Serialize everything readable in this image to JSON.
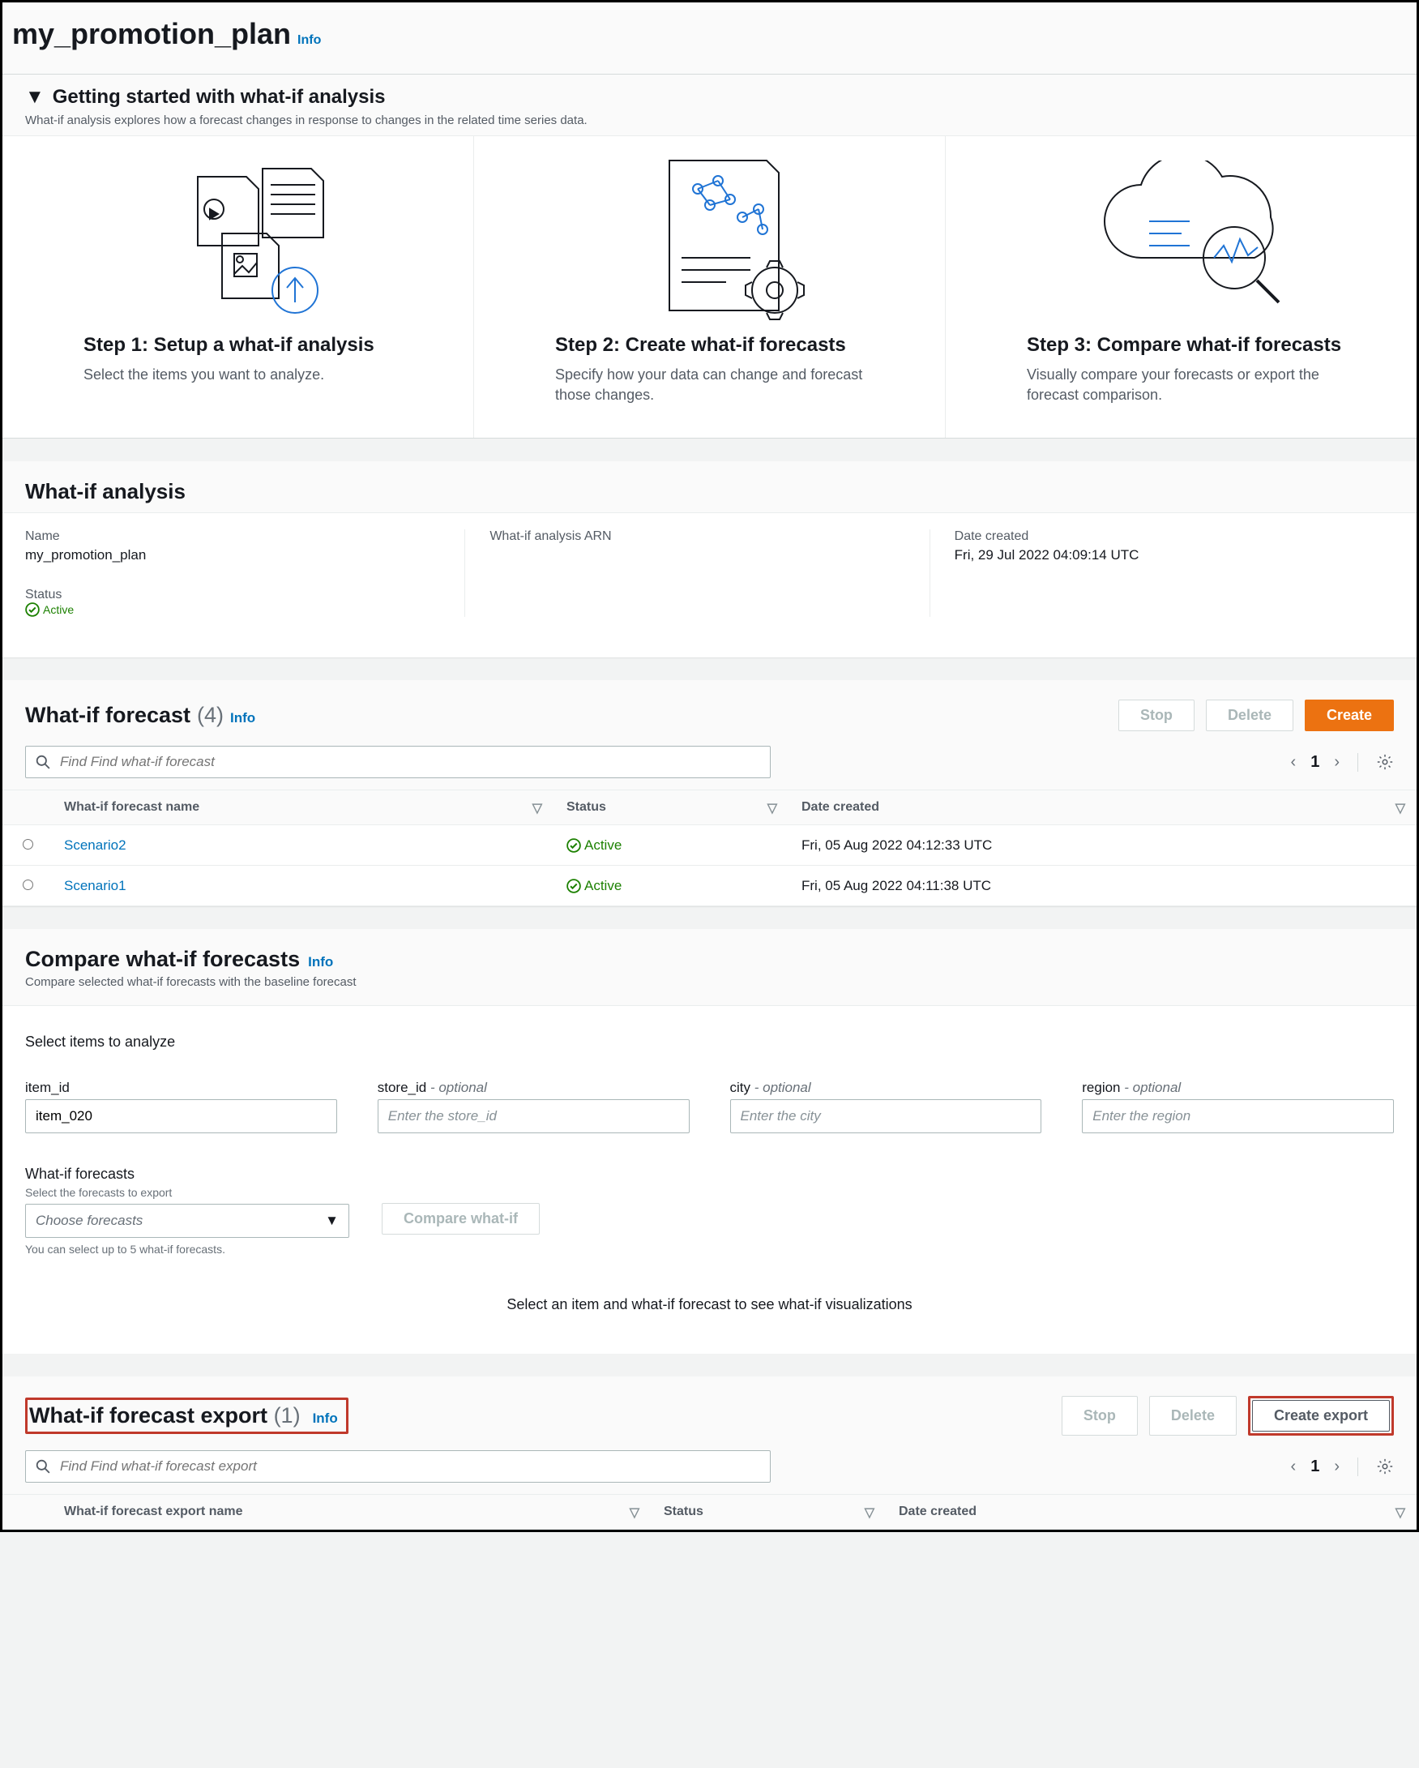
{
  "page": {
    "title": "my_promotion_plan",
    "info": "Info"
  },
  "getting_started": {
    "title": "Getting started with what-if analysis",
    "desc": "What-if analysis explores how a forecast changes in response to changes in the related time series data.",
    "steps": [
      {
        "title": "Step 1: Setup a what-if analysis",
        "desc": "Select the items you want to analyze."
      },
      {
        "title": "Step 2: Create what-if forecasts",
        "desc": "Specify how your data can change and forecast those changes."
      },
      {
        "title": "Step 3: Compare what-if forecasts",
        "desc": "Visually compare your forecasts or export the forecast comparison."
      }
    ]
  },
  "analysis": {
    "header": "What-if analysis",
    "name_label": "Name",
    "name_value": "my_promotion_plan",
    "arn_label": "What-if analysis ARN",
    "date_label": "Date created",
    "date_value": "Fri, 29 Jul 2022 04:09:14 UTC",
    "status_label": "Status",
    "status_value": "Active"
  },
  "forecast": {
    "title": "What-if forecast",
    "count": "(4)",
    "info": "Info",
    "stop": "Stop",
    "delete": "Delete",
    "create": "Create",
    "search_placeholder": "Find Find what-if forecast",
    "page_current": "1",
    "columns": {
      "name": "What-if forecast name",
      "status": "Status",
      "date": "Date created"
    },
    "rows": [
      {
        "name": "Scenario2",
        "status": "Active",
        "date": "Fri, 05 Aug 2022 04:12:33 UTC"
      },
      {
        "name": "Scenario1",
        "status": "Active",
        "date": "Fri, 05 Aug 2022 04:11:38 UTC"
      }
    ]
  },
  "compare": {
    "title": "Compare what-if forecasts",
    "info": "Info",
    "sub": "Compare selected what-if forecasts with the baseline forecast",
    "select_items_label": "Select items to analyze",
    "item_id_label": "item_id",
    "item_id_value": "item_020",
    "store_label": "store_id",
    "store_placeholder": "Enter the store_id",
    "city_label": "city",
    "city_placeholder": "Enter the city",
    "region_label": "region",
    "region_placeholder": "Enter the region",
    "optional": "- optional",
    "wif_label": "What-if forecasts",
    "wif_sub": "Select the forecasts to export",
    "dropdown_placeholder": "Choose forecasts",
    "hint": "You can select up to 5 what-if forecasts.",
    "compare_btn": "Compare what-if",
    "viz_placeholder": "Select an item and what-if forecast to see what-if visualizations"
  },
  "export": {
    "title": "What-if forecast export",
    "count": "(1)",
    "info": "Info",
    "stop": "Stop",
    "delete": "Delete",
    "create": "Create export",
    "search_placeholder": "Find Find what-if forecast export",
    "page_current": "1",
    "columns": {
      "name": "What-if forecast export name",
      "status": "Status",
      "date": "Date created"
    }
  }
}
